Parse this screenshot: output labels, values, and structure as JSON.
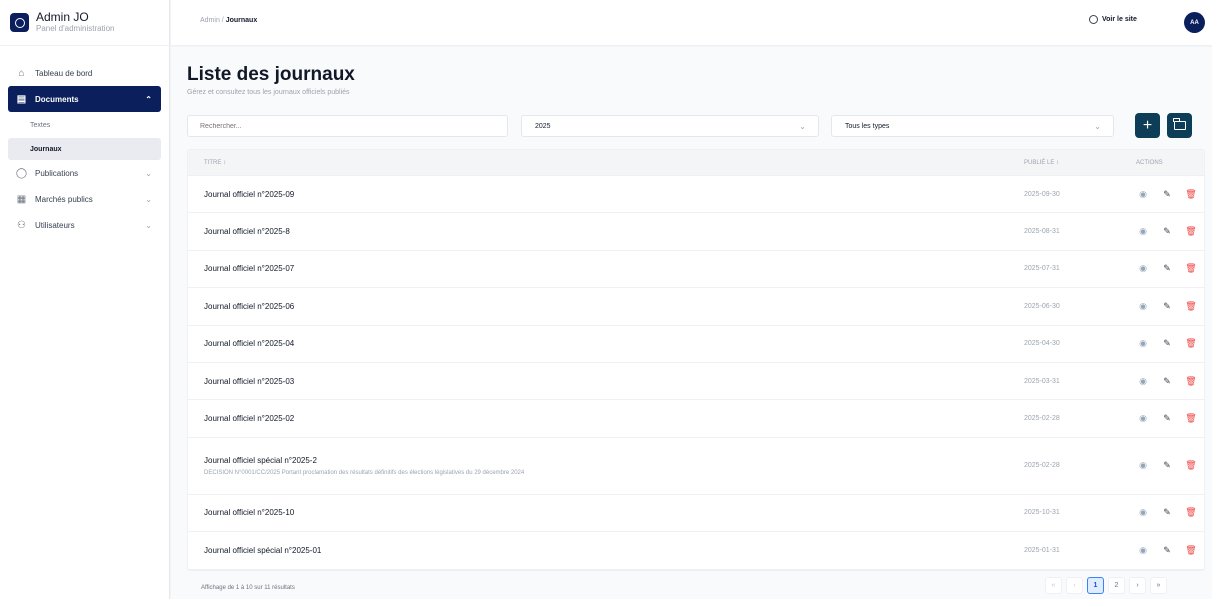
{
  "app": {
    "name": "Admin JO",
    "subtitle": "Panel d'administration"
  },
  "sidebar": {
    "items": [
      {
        "label": "Tableau de bord",
        "icon": "home-icon"
      },
      {
        "label": "Documents",
        "icon": "document-icon",
        "expanded": true
      },
      {
        "label": "Publications",
        "icon": "megaphone-icon"
      },
      {
        "label": "Marchés publics",
        "icon": "building-icon"
      },
      {
        "label": "Utilisateurs",
        "icon": "users-icon"
      }
    ],
    "documents_sub": [
      {
        "label": "Textes"
      },
      {
        "label": "Journaux"
      }
    ]
  },
  "topbar": {
    "breadcrumb_root": "Admin",
    "breadcrumb_sep": "/",
    "breadcrumb_current": "Journaux",
    "view_site": "Voir le site",
    "avatar_initials": "AA"
  },
  "page": {
    "title": "Liste des journaux",
    "subtitle": "Gérez et consultez tous les journaux officiels publiés"
  },
  "filters": {
    "search_placeholder": "Rechercher...",
    "year_value": "2025",
    "type_value": "Tous les types"
  },
  "table": {
    "headers": {
      "title": "TITRE ↕",
      "date": "PUBLIÉ LE ↕",
      "actions": "ACTIONS"
    },
    "rows": [
      {
        "title": "Journal officiel n°2025-09",
        "date": "2025-09-30"
      },
      {
        "title": "Journal officiel n°2025-8",
        "date": "2025-08-31"
      },
      {
        "title": "Journal officiel n°2025-07",
        "date": "2025-07-31"
      },
      {
        "title": "Journal officiel n°2025-06",
        "date": "2025-06-30"
      },
      {
        "title": "Journal officiel n°2025-04",
        "date": "2025-04-30"
      },
      {
        "title": "Journal officiel n°2025-03",
        "date": "2025-03-31"
      },
      {
        "title": "Journal officiel n°2025-02",
        "date": "2025-02-28"
      },
      {
        "title": "Journal officiel spécial n°2025-2",
        "date": "2025-02-28",
        "description": "DECISION N°0001/CC/2025 Portant proclamation des résultats définitifs des élections législatives du 29 décembre 2024"
      },
      {
        "title": "Journal officiel n°2025-10",
        "date": "2025-10-31"
      },
      {
        "title": "Journal officiel spécial n°2025-01",
        "date": "2025-01-31"
      }
    ]
  },
  "footer": {
    "info": "Affichage de 1 à 10 sur 11 résultats"
  },
  "pagination": {
    "first": "«",
    "prev": "‹",
    "pages": [
      "1",
      "2"
    ],
    "next": "›",
    "last": "»"
  },
  "colors": {
    "brand_navy": "#0b1f5c",
    "button_teal": "#0d3d57",
    "delete_red": "#ef4444"
  }
}
